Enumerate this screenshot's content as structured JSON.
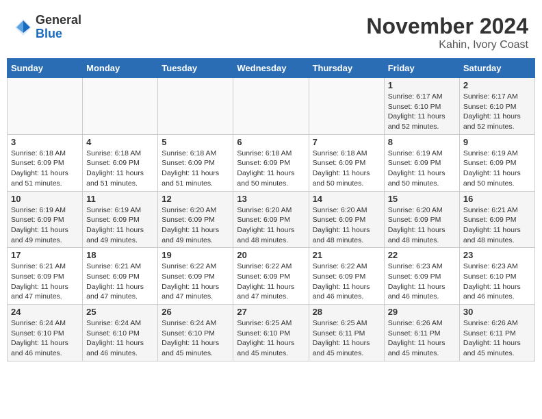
{
  "logo": {
    "general": "General",
    "blue": "Blue"
  },
  "title": "November 2024",
  "location": "Kahin, Ivory Coast",
  "days_of_week": [
    "Sunday",
    "Monday",
    "Tuesday",
    "Wednesday",
    "Thursday",
    "Friday",
    "Saturday"
  ],
  "weeks": [
    [
      {
        "day": "",
        "info": ""
      },
      {
        "day": "",
        "info": ""
      },
      {
        "day": "",
        "info": ""
      },
      {
        "day": "",
        "info": ""
      },
      {
        "day": "",
        "info": ""
      },
      {
        "day": "1",
        "info": "Sunrise: 6:17 AM\nSunset: 6:10 PM\nDaylight: 11 hours and 52 minutes."
      },
      {
        "day": "2",
        "info": "Sunrise: 6:17 AM\nSunset: 6:10 PM\nDaylight: 11 hours and 52 minutes."
      }
    ],
    [
      {
        "day": "3",
        "info": "Sunrise: 6:18 AM\nSunset: 6:09 PM\nDaylight: 11 hours and 51 minutes."
      },
      {
        "day": "4",
        "info": "Sunrise: 6:18 AM\nSunset: 6:09 PM\nDaylight: 11 hours and 51 minutes."
      },
      {
        "day": "5",
        "info": "Sunrise: 6:18 AM\nSunset: 6:09 PM\nDaylight: 11 hours and 51 minutes."
      },
      {
        "day": "6",
        "info": "Sunrise: 6:18 AM\nSunset: 6:09 PM\nDaylight: 11 hours and 50 minutes."
      },
      {
        "day": "7",
        "info": "Sunrise: 6:18 AM\nSunset: 6:09 PM\nDaylight: 11 hours and 50 minutes."
      },
      {
        "day": "8",
        "info": "Sunrise: 6:19 AM\nSunset: 6:09 PM\nDaylight: 11 hours and 50 minutes."
      },
      {
        "day": "9",
        "info": "Sunrise: 6:19 AM\nSunset: 6:09 PM\nDaylight: 11 hours and 50 minutes."
      }
    ],
    [
      {
        "day": "10",
        "info": "Sunrise: 6:19 AM\nSunset: 6:09 PM\nDaylight: 11 hours and 49 minutes."
      },
      {
        "day": "11",
        "info": "Sunrise: 6:19 AM\nSunset: 6:09 PM\nDaylight: 11 hours and 49 minutes."
      },
      {
        "day": "12",
        "info": "Sunrise: 6:20 AM\nSunset: 6:09 PM\nDaylight: 11 hours and 49 minutes."
      },
      {
        "day": "13",
        "info": "Sunrise: 6:20 AM\nSunset: 6:09 PM\nDaylight: 11 hours and 48 minutes."
      },
      {
        "day": "14",
        "info": "Sunrise: 6:20 AM\nSunset: 6:09 PM\nDaylight: 11 hours and 48 minutes."
      },
      {
        "day": "15",
        "info": "Sunrise: 6:20 AM\nSunset: 6:09 PM\nDaylight: 11 hours and 48 minutes."
      },
      {
        "day": "16",
        "info": "Sunrise: 6:21 AM\nSunset: 6:09 PM\nDaylight: 11 hours and 48 minutes."
      }
    ],
    [
      {
        "day": "17",
        "info": "Sunrise: 6:21 AM\nSunset: 6:09 PM\nDaylight: 11 hours and 47 minutes."
      },
      {
        "day": "18",
        "info": "Sunrise: 6:21 AM\nSunset: 6:09 PM\nDaylight: 11 hours and 47 minutes."
      },
      {
        "day": "19",
        "info": "Sunrise: 6:22 AM\nSunset: 6:09 PM\nDaylight: 11 hours and 47 minutes."
      },
      {
        "day": "20",
        "info": "Sunrise: 6:22 AM\nSunset: 6:09 PM\nDaylight: 11 hours and 47 minutes."
      },
      {
        "day": "21",
        "info": "Sunrise: 6:22 AM\nSunset: 6:09 PM\nDaylight: 11 hours and 46 minutes."
      },
      {
        "day": "22",
        "info": "Sunrise: 6:23 AM\nSunset: 6:09 PM\nDaylight: 11 hours and 46 minutes."
      },
      {
        "day": "23",
        "info": "Sunrise: 6:23 AM\nSunset: 6:10 PM\nDaylight: 11 hours and 46 minutes."
      }
    ],
    [
      {
        "day": "24",
        "info": "Sunrise: 6:24 AM\nSunset: 6:10 PM\nDaylight: 11 hours and 46 minutes."
      },
      {
        "day": "25",
        "info": "Sunrise: 6:24 AM\nSunset: 6:10 PM\nDaylight: 11 hours and 46 minutes."
      },
      {
        "day": "26",
        "info": "Sunrise: 6:24 AM\nSunset: 6:10 PM\nDaylight: 11 hours and 45 minutes."
      },
      {
        "day": "27",
        "info": "Sunrise: 6:25 AM\nSunset: 6:10 PM\nDaylight: 11 hours and 45 minutes."
      },
      {
        "day": "28",
        "info": "Sunrise: 6:25 AM\nSunset: 6:11 PM\nDaylight: 11 hours and 45 minutes."
      },
      {
        "day": "29",
        "info": "Sunrise: 6:26 AM\nSunset: 6:11 PM\nDaylight: 11 hours and 45 minutes."
      },
      {
        "day": "30",
        "info": "Sunrise: 6:26 AM\nSunset: 6:11 PM\nDaylight: 11 hours and 45 minutes."
      }
    ]
  ]
}
